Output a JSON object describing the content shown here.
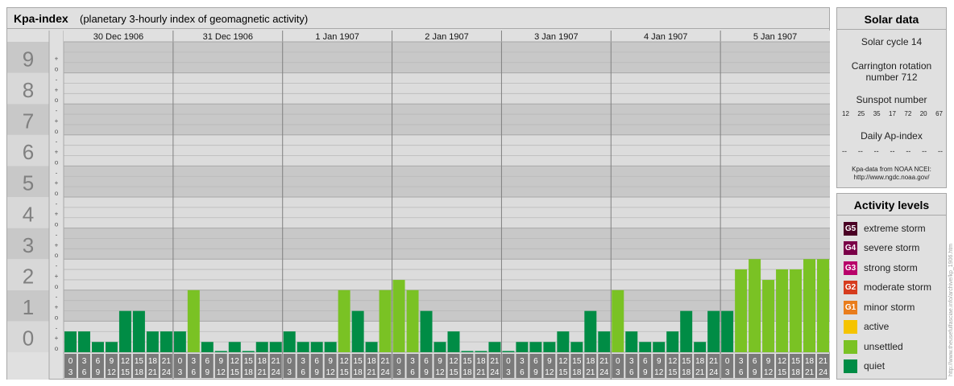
{
  "header": {
    "title": "Kpa-index",
    "subtitle": "(planetary 3-hourly index of geomagnetic activity)"
  },
  "chart_data": {
    "type": "bar",
    "title": "Kpa-index",
    "subtitle": "(planetary 3-hourly index of geomagnetic activity)",
    "ylim": [
      0,
      9
    ],
    "y_ticks": [
      "0",
      "1",
      "2",
      "3",
      "4",
      "5",
      "6",
      "7",
      "8",
      "9"
    ],
    "minor_marks": [
      "o",
      "+",
      "-"
    ],
    "days": [
      "30 Dec 1906",
      "31 Dec 1906",
      "1 Jan 1907",
      "2 Jan 1907",
      "3 Jan 1907",
      "4 Jan 1907",
      "5 Jan 1907"
    ],
    "interval_labels": [
      [
        "0",
        "3"
      ],
      [
        "3",
        "6"
      ],
      [
        "6",
        "9"
      ],
      [
        "9",
        "12"
      ],
      [
        "12",
        "15"
      ],
      [
        "15",
        "18"
      ],
      [
        "18",
        "21"
      ],
      [
        "21",
        "24"
      ]
    ],
    "values": [
      [
        0.67,
        0.67,
        0.33,
        0.33,
        1.33,
        1.33,
        0.67,
        0.67
      ],
      [
        0.67,
        2.0,
        0.33,
        0.0,
        0.33,
        0.0,
        0.33,
        0.33
      ],
      [
        0.67,
        0.33,
        0.33,
        0.33,
        2.0,
        1.33,
        0.33,
        2.0
      ],
      [
        2.33,
        2.0,
        1.33,
        0.33,
        0.67,
        0.0,
        0.0,
        0.33
      ],
      [
        0.0,
        0.33,
        0.33,
        0.33,
        0.67,
        0.33,
        1.33,
        0.67
      ],
      [
        2.0,
        0.67,
        0.33,
        0.33,
        0.67,
        1.33,
        0.33,
        1.33
      ],
      [
        1.33,
        2.67,
        3.0,
        2.33,
        2.67,
        2.67,
        3.0,
        3.0
      ]
    ],
    "level_colors": {
      "quiet": "#008c45",
      "unsettled": "#7ac224",
      "active": "#f5c400"
    },
    "grid": true
  },
  "solar": {
    "title": "Solar data",
    "cycle": "Solar cycle 14",
    "carrington_line1": "Carrington rotation",
    "carrington_line2": "number 712",
    "sunspot_label": "Sunspot number",
    "sunspot_values": [
      "12",
      "25",
      "35",
      "17",
      "72",
      "20",
      "67"
    ],
    "ap_label": "Daily Ap-index",
    "ap_values": [
      "--",
      "--",
      "--",
      "--",
      "--",
      "--",
      "--"
    ],
    "credit_line1": "Kpa-data from NOAA NCEI:",
    "credit_line2": "http://www.ngdc.noaa.gov/"
  },
  "activity": {
    "title": "Activity levels",
    "levels": [
      {
        "code": "G5",
        "label": "extreme storm",
        "color": "#4a0024"
      },
      {
        "code": "G4",
        "label": "severe storm",
        "color": "#7a0048"
      },
      {
        "code": "G3",
        "label": "strong storm",
        "color": "#b8006a"
      },
      {
        "code": "G2",
        "label": "moderate storm",
        "color": "#d63c1e"
      },
      {
        "code": "G1",
        "label": "minor storm",
        "color": "#e97d1c"
      },
      {
        "code": "",
        "label": "active",
        "color": "#f5c400"
      },
      {
        "code": "",
        "label": "unsettled",
        "color": "#7ac224"
      },
      {
        "code": "",
        "label": "quiet",
        "color": "#008c45"
      }
    ]
  },
  "watermark": "http://www.theusefulfasciae.info/archive/kp_1906.htm"
}
